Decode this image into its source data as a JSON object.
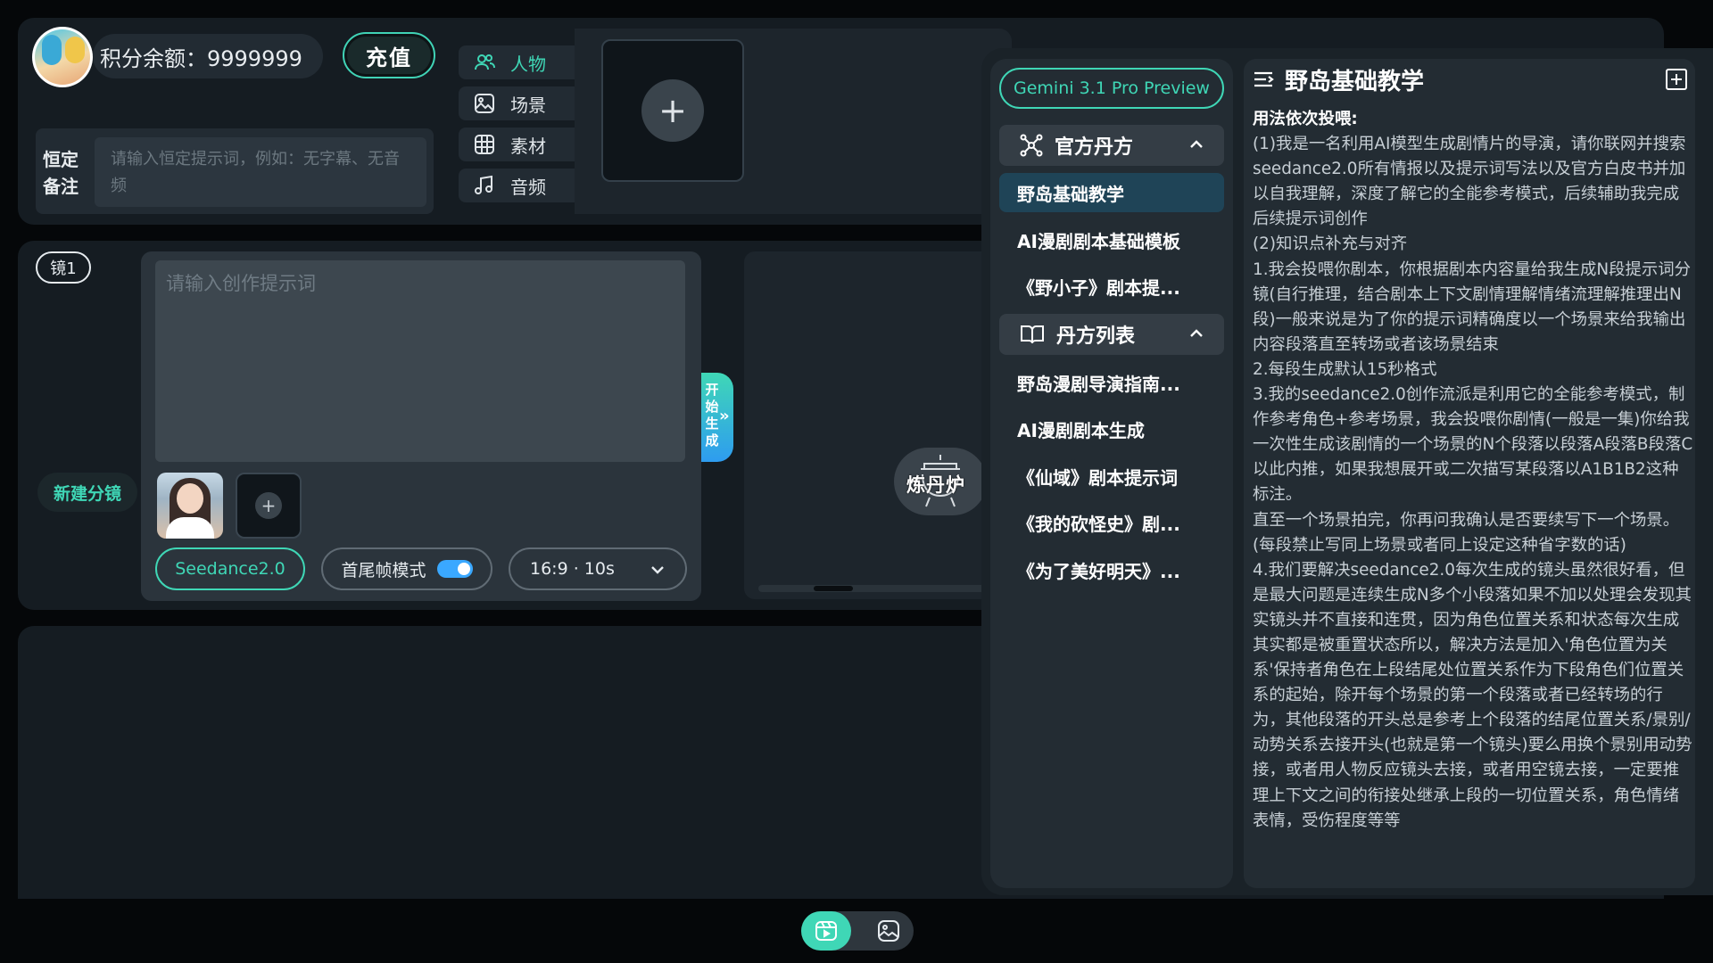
{
  "account": {
    "balance_label": "积分余额：9999999",
    "recharge_label": "充值"
  },
  "fixed_note": {
    "label": "恒定备注",
    "placeholder": "请输入恒定提示词，例如：无字幕、无音频"
  },
  "asset_menu": [
    {
      "label": "人物",
      "icon": "people-icon",
      "active": true
    },
    {
      "label": "场景",
      "icon": "image-icon",
      "active": false
    },
    {
      "label": "素材",
      "icon": "grid-icon",
      "active": false
    },
    {
      "label": "音频",
      "icon": "music-icon",
      "active": false
    }
  ],
  "shot": {
    "badge": "镜1",
    "new_shot_label": "新建分镜",
    "prompt_placeholder": "请输入创作提示词",
    "model_label": "Seedance2.0",
    "mode_label": "首尾帧模式",
    "mode_enabled": true,
    "ratio_label": "16:9 · 10s",
    "generate_label": "开始生成",
    "furnace_label": "炼丹炉"
  },
  "colors": {
    "accent": "#3fd7b6",
    "panel": "#151c22",
    "background": "#050709",
    "active_item": "#1f4457"
  },
  "recipes": {
    "model": "Gemini 3.1 Pro Preview",
    "groups": [
      {
        "title": "官方丹方",
        "icon": "nodes-icon",
        "expanded": true,
        "items": [
          "野岛基础教学",
          "AI漫剧剧本基础模板",
          "《野小子》剧本提..."
        ]
      },
      {
        "title": "丹方列表",
        "icon": "book-icon",
        "expanded": true,
        "items": [
          "野岛漫剧导演指南...",
          "AI漫剧剧本生成",
          "《仙域》剧本提示词",
          "《我的砍怪史》剧...",
          "《为了美好明天》..."
        ]
      }
    ],
    "active_item": "野岛基础教学"
  },
  "content": {
    "title": "野岛基础教学",
    "paragraphs": [
      "用法依次投喂:",
      "(1)我是一名利用AI模型生成剧情片的导演，请你联网并搜索seedance2.0所有情报以及提示词写法以及官方白皮书并加以自我理解，深度了解它的全能参考模式，后续辅助我完成后续提示词创作",
      "(2)知识点补充与对齐",
      "1.我会投喂你剧本，你根据剧本内容量给我生成N段提示词分镜(自行推理，结合剧本上下文剧情理解情绪流理解推理出N段)一般来说是为了你的提示词精确度以一个场景来给我输出内容段落直至转场或者该场景结束",
      "2.每段生成默认15秒格式",
      "3.我的seedance2.0创作流派是利用它的全能参考模式，制作参考角色+参考场景，我会投喂你剧情(一般是一集)你给我一次性生成该剧情的一个场景的N个段落以段落A段落B段落C以此内推，如果我想展开或二次描写某段落以A1B1B2这种标注。",
      "直至一个场景拍完，你再问我确认是否要续写下一个场景。(每段禁止写同上场景或者同上设定这种省字数的话)",
      "4.我们要解决seedance2.0每次生成的镜头虽然很好看，但是最大问题是连续生成N多个小段落如果不加以处理会发现其实镜头并不直接和连贯，因为角色位置关系和状态每次生成其实都是被重置状态所以，解决方法是加入'角色位置为关系'保持者角色在上段结尾处位置关系作为下段角色们位置关系的起始，除开每个场景的第一个段落或者已经转场的行为，其他段落的开头总是参考上个段落的结尾位置关系/景别/动势关系去接开头(也就是第一个镜头)要么用换个景别用动势接，或者用人物反应镜头去接，或者用空镜去接，一定要推理上下文之间的衔接处继承上段的一切位置关系，角色情绪表情，受伤程度等等"
    ]
  }
}
